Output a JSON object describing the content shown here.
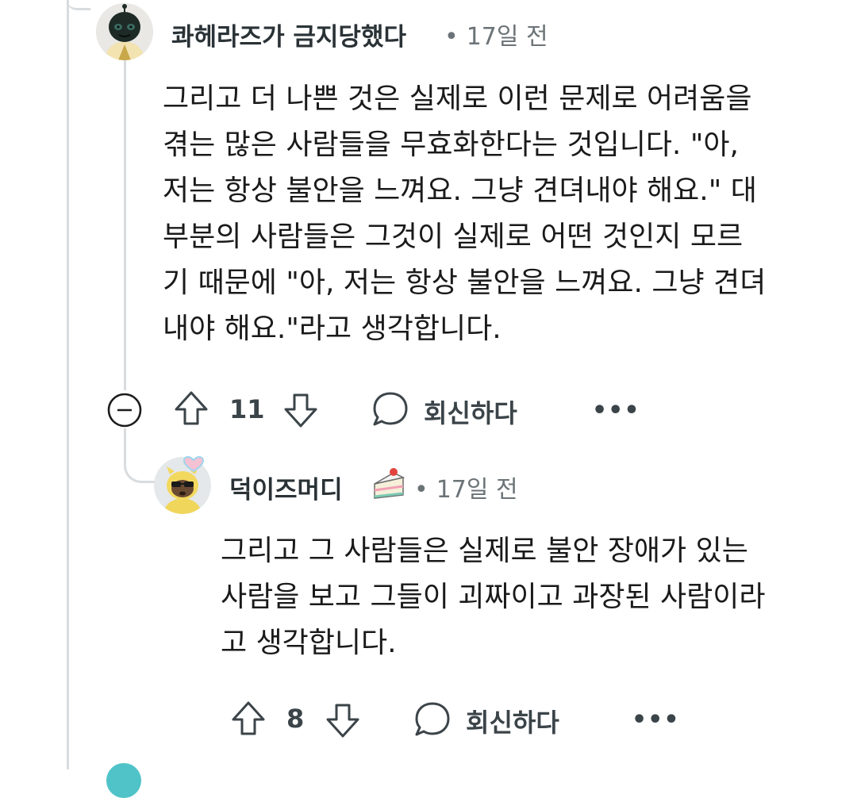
{
  "comments": [
    {
      "username": "콰헤라즈가 금지당했다",
      "timestamp": "17일 전",
      "body_lines": [
        "그리고 더 나쁜 것은 실제로 이런 문제로 어려움을",
        "겪는 많은 사람들을 무효화한다는 것입니다. \"아,",
        "저는 항상 불안을 느껴요. 그냥 견뎌내야 해요.\" 대",
        "부분의 사람들은 그것이 실제로 어떤 것인지 모르",
        "기 때문에 \"아, 저는 항상 불안을 느껴요. 그냥 견뎌",
        "내야 해요.\"라고 생각합니다."
      ],
      "vote_count": "11",
      "reply_label": "회신하다",
      "more_label": "•••",
      "icons": [
        "collapse-icon",
        "upvote-icon",
        "downvote-icon",
        "comment-bubble-icon",
        "more-icon"
      ]
    },
    {
      "username": "덕이즈머디",
      "timestamp": "17일 전",
      "flair": "cake-icon",
      "body_lines": [
        "그리고 그 사람들은 실제로 불안 장애가 있는",
        "사람을 보고 그들이 괴짜이고 과장된 사람이라",
        "고 생각합니다."
      ],
      "vote_count": "8",
      "reply_label": "회신하다",
      "more_label": "•••",
      "icons": [
        "upvote-icon",
        "downvote-icon",
        "comment-bubble-icon",
        "more-icon"
      ]
    }
  ],
  "colors": {
    "thread_line": "#d9dcdf",
    "meta_text": "#6b7377",
    "username_text": "#2a3236",
    "body_text": "#1a1a1b"
  }
}
